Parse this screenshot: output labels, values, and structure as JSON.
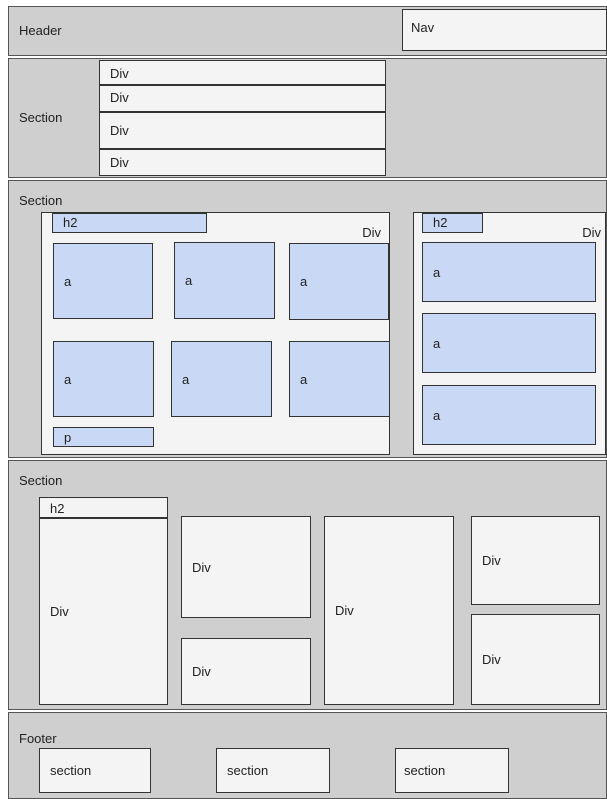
{
  "header": {
    "label": "Header",
    "nav": "Nav"
  },
  "section1": {
    "label": "Section",
    "divs": [
      "Div",
      "Div",
      "Div",
      "Div"
    ]
  },
  "section2": {
    "label": "Section",
    "left": {
      "h2": "h2",
      "label": "Div",
      "links": [
        "a",
        "a",
        "a",
        "a",
        "a",
        "a"
      ],
      "p": "p"
    },
    "right": {
      "h2": "h2",
      "label": "Div",
      "links": [
        "a",
        "a",
        "a"
      ]
    }
  },
  "section3": {
    "label": "Section",
    "h2": "h2",
    "divs": [
      "Div",
      "Div",
      "Div",
      "Div",
      "Div",
      "Div"
    ]
  },
  "footer": {
    "label": "Footer",
    "sections": [
      "section",
      "section",
      "section"
    ]
  }
}
